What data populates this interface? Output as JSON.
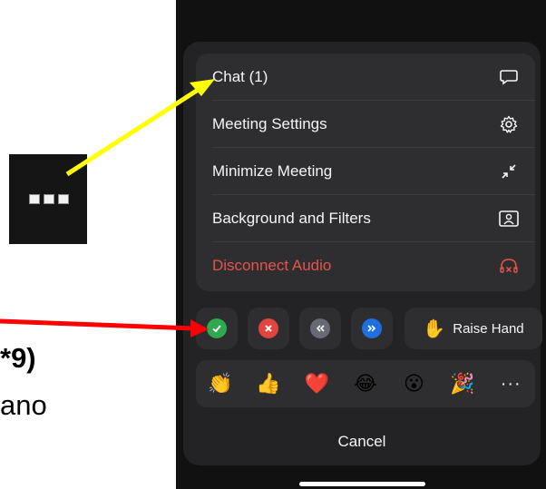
{
  "annotation": {
    "side_text_bold": "*9)",
    "side_text": "ano",
    "arrow_colors": {
      "yellow": "#ffff00",
      "red": "#ff0000"
    }
  },
  "menu": {
    "items": [
      {
        "label": "Chat (1)",
        "icon": "chat-bubble-icon"
      },
      {
        "label": "Meeting Settings",
        "icon": "gear-icon"
      },
      {
        "label": "Minimize Meeting",
        "icon": "minimize-icon"
      },
      {
        "label": "Background and Filters",
        "icon": "background-portrait-icon"
      },
      {
        "label": "Disconnect Audio",
        "icon": "headphones-disconnect-icon",
        "color": "#e5534b"
      }
    ]
  },
  "nonverbal": {
    "buttons": [
      {
        "name": "yes",
        "icon": "check-icon",
        "color": "#2fa84f"
      },
      {
        "name": "no",
        "icon": "close-icon",
        "color": "#e0463f"
      },
      {
        "name": "slower",
        "icon": "rewind-icon",
        "color": "#676a75"
      },
      {
        "name": "faster",
        "icon": "fast-forward-icon",
        "color": "#1f6fe0"
      }
    ],
    "raise_hand_label": "Raise Hand",
    "raise_hand_emoji": "✋"
  },
  "reactions": {
    "emojis": [
      "👏",
      "👍",
      "❤️",
      "😂",
      "😮",
      "🎉"
    ],
    "more_label": "···"
  },
  "cancel_label": "Cancel"
}
